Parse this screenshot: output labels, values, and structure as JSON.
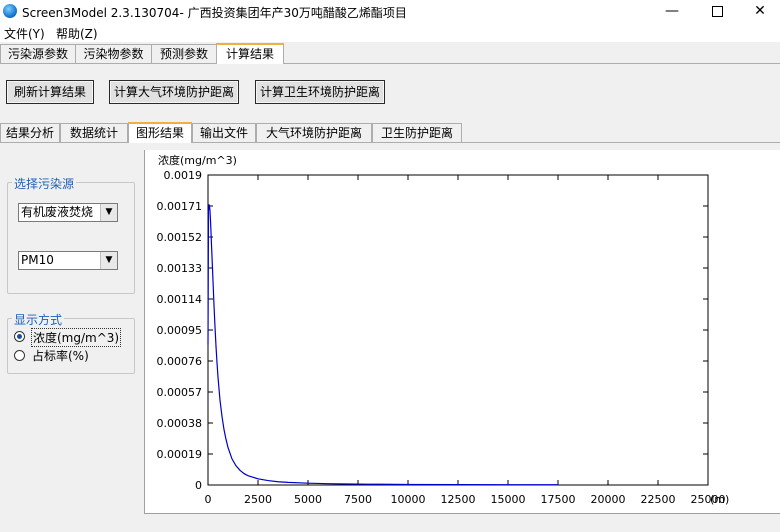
{
  "window": {
    "title": "Screen3Model 2.3.130704- 广西投资集团年产30万吨醋酸乙烯酯项目",
    "min_glyph": "—",
    "close_glyph": "✕"
  },
  "menu": [
    "文件(Y)",
    "帮助(Z)"
  ],
  "top_tabs": [
    {
      "label": "污染源参数",
      "active": false
    },
    {
      "label": "污染物参数",
      "active": false
    },
    {
      "label": "预测参数",
      "active": false
    },
    {
      "label": "计算结果",
      "active": true
    }
  ],
  "buttons": {
    "refresh": "刷新计算结果",
    "atmos": "计算大气环境防护距离",
    "hygiene": "计算卫生环境防护距离"
  },
  "sub_tabs": [
    {
      "label": "结果分析",
      "active": false
    },
    {
      "label": "数据统计",
      "active": false
    },
    {
      "label": "图形结果",
      "active": true
    },
    {
      "label": "输出文件",
      "active": false
    },
    {
      "label": "大气环境防护距离",
      "active": false
    },
    {
      "label": "卫生防护距离",
      "active": false
    }
  ],
  "source_group": {
    "legend": "选择污染源",
    "source_value": "有机废液焚烧",
    "pollutant_value": "PM10"
  },
  "display_group": {
    "legend": "显示方式",
    "options": [
      {
        "label": "浓度(mg/m^3)",
        "selected": true
      },
      {
        "label": "占标率(%)",
        "selected": false
      }
    ]
  },
  "chart_data": {
    "type": "line",
    "ylabel": "浓度(mg/m^3)",
    "xunit": "(m)",
    "x_ticks": [
      0,
      2500,
      5000,
      7500,
      10000,
      12500,
      15000,
      17500,
      20000,
      22500,
      25000
    ],
    "y_ticks": [
      "0",
      "0.00019",
      "0.00038",
      "0.00057",
      "0.00076",
      "0.00095",
      "0.00114",
      "0.00133",
      "0.00152",
      "0.00171",
      "0.0019"
    ],
    "xlim": [
      0,
      25000
    ],
    "ylim": [
      0,
      0.0019
    ],
    "line_color": "#0000cc",
    "series": [
      {
        "x": [
          0,
          25,
          50,
          75,
          100,
          125,
          150,
          175,
          200,
          250,
          300,
          350,
          400,
          450,
          500,
          600,
          700,
          800,
          900,
          1000,
          1200,
          1400,
          1600,
          1800,
          2000,
          2500,
          3000,
          3500,
          4000,
          5000,
          6000,
          7000,
          8000,
          10000,
          12500,
          15000,
          17500
        ],
        "y": [
          0.00086,
          0.00168,
          0.00172,
          0.00171,
          0.00168,
          0.00162,
          0.00155,
          0.00147,
          0.0014,
          0.00125,
          0.0011,
          0.00097,
          0.00085,
          0.00075,
          0.00066,
          0.00052,
          0.00042,
          0.00034,
          0.00028,
          0.00023,
          0.00016,
          0.000118,
          9e-05,
          7e-05,
          5.7e-05,
          3.8e-05,
          2.7e-05,
          2e-05,
          1.6e-05,
          1.1e-05,
          8e-06,
          6e-06,
          5e-06,
          3.5e-06,
          2.5e-06,
          2e-06,
          1.6e-06
        ]
      }
    ]
  }
}
